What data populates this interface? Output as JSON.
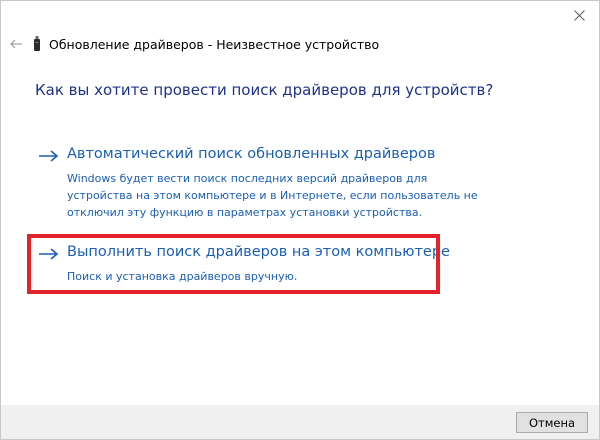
{
  "window": {
    "title": "Обновление драйверов - Неизвестное устройство",
    "close_icon": "close-icon",
    "back_icon": "back-arrow-icon",
    "device_icon": "usb-device-icon"
  },
  "main": {
    "question": "Как вы хотите провести поиск драйверов для устройств?",
    "options": [
      {
        "title": "Автоматический поиск обновленных драйверов",
        "description": "Windows будет вести поиск последних версий драйверов для устройства на этом компьютере и в Интернете, если пользователь не отключил эту функцию в параметрах установки устройства.",
        "icon": "arrow-right-icon"
      },
      {
        "title": "Выполнить поиск драйверов на этом компьютере",
        "description": "Поиск и установка драйверов вручную.",
        "icon": "arrow-right-icon",
        "highlighted": true
      }
    ]
  },
  "footer": {
    "cancel_label": "Отмена"
  },
  "colors": {
    "link_blue": "#1a5fb4",
    "question_blue": "#1e3287",
    "highlight_red": "#e3232c",
    "footer_bg": "#f0f0f0"
  }
}
